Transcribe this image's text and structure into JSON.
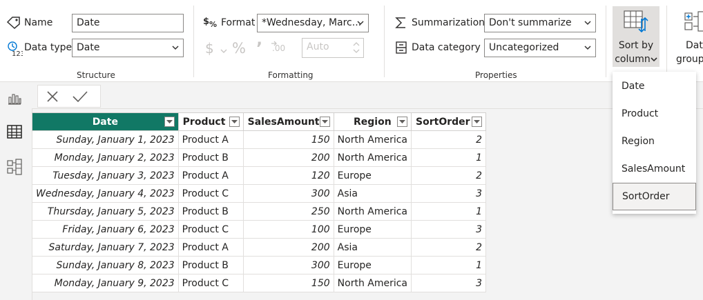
{
  "structure": {
    "name_label": "Name",
    "name_value": "Date",
    "datatype_label": "Data type",
    "datatype_value": "Date",
    "group_title": "Structure"
  },
  "formatting": {
    "format_label": "Format",
    "format_value": "*Wednesday, Marc...",
    "currency_symbol": "$",
    "percent_symbol": "%",
    "comma_symbol": "’",
    "decimals_symbol": ".00",
    "auto_value": "Auto",
    "group_title": "Formatting"
  },
  "properties": {
    "summarization_label": "Summarization",
    "summarization_value": "Don't summarize",
    "category_label": "Data category",
    "category_value": "Uncategorized",
    "group_title": "Properties"
  },
  "sort_button": {
    "line1": "Sort by",
    "line2": "column"
  },
  "data_groups_button": {
    "line1": "Dat",
    "line2": "group"
  },
  "sort_menu": {
    "items": [
      "Date",
      "Product",
      "Region",
      "SalesAmount",
      "SortOrder"
    ],
    "highlighted": "SortOrder"
  },
  "table": {
    "columns": [
      "Date",
      "Product",
      "SalesAmount",
      "Region",
      "SortOrder"
    ],
    "selected_column": "Date",
    "rows": [
      [
        "Sunday, January 1, 2023",
        "Product A",
        "150",
        "North America",
        "2"
      ],
      [
        "Monday, January 2, 2023",
        "Product B",
        "200",
        "North America",
        "1"
      ],
      [
        "Tuesday, January 3, 2023",
        "Product A",
        "120",
        "Europe",
        "2"
      ],
      [
        "Wednesday, January 4, 2023",
        "Product C",
        "300",
        "Asia",
        "3"
      ],
      [
        "Thursday, January 5, 2023",
        "Product B",
        "250",
        "North America",
        "1"
      ],
      [
        "Friday, January 6, 2023",
        "Product C",
        "100",
        "Europe",
        "3"
      ],
      [
        "Saturday, January 7, 2023",
        "Product A",
        "200",
        "Asia",
        "2"
      ],
      [
        "Sunday, January 8, 2023",
        "Product B",
        "300",
        "Europe",
        "1"
      ],
      [
        "Monday, January 9, 2023",
        "Product C",
        "150",
        "North America",
        "3"
      ]
    ]
  },
  "colors": {
    "selected_header": "#117865",
    "ribbon_bg": "#ffffff",
    "accent_blue": "#0078d4"
  },
  "icons": {
    "name": "tag-icon",
    "datatype": "number-123-icon",
    "format": "format-dollar-percent-icon",
    "summarization": "sigma-icon",
    "category": "data-category-icon",
    "sort": "sort-by-column-icon",
    "sidebar": [
      "report-view-icon",
      "table-view-icon",
      "model-view-icon"
    ],
    "formula": [
      "cancel-x-icon",
      "commit-check-icon"
    ]
  }
}
